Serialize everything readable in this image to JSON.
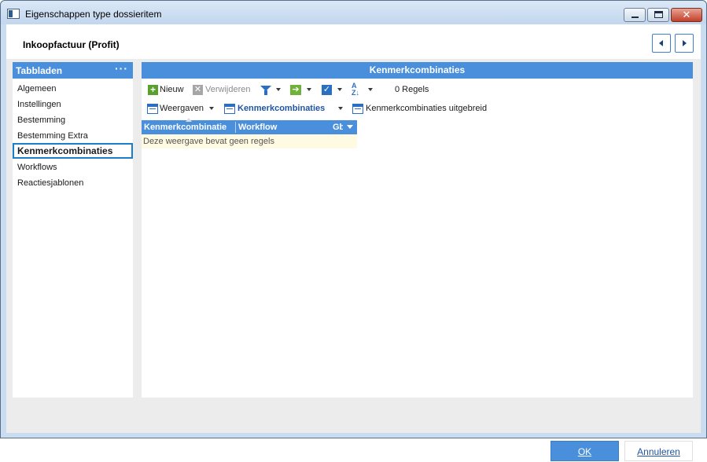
{
  "window": {
    "title": "Eigenschappen type dossieritem"
  },
  "header": {
    "title": "Inkoopfactuur (Profit)"
  },
  "sidebar": {
    "title": "Tabbladen",
    "more_icon": "ellipsis-icon",
    "items": [
      {
        "label": "Algemeen",
        "active": false
      },
      {
        "label": "Instellingen",
        "active": false
      },
      {
        "label": "Bestemming",
        "active": false
      },
      {
        "label": "Bestemming Extra",
        "active": false
      },
      {
        "label": "Kenmerkcombinaties",
        "active": true
      },
      {
        "label": "Workflows",
        "active": false
      },
      {
        "label": "Reactiesjablonen",
        "active": false
      }
    ]
  },
  "main": {
    "title": "Kenmerkcombinaties",
    "toolbar1": {
      "new_label": "Nieuw",
      "delete_label": "Verwijderen",
      "row_count": "0 Regels"
    },
    "toolbar2": {
      "views_label": "Weergaven",
      "current_view_label": "Kenmerkcombinaties",
      "extended_view_label": "Kenmerkcombinaties uitgebreid"
    },
    "grid": {
      "columns": [
        "Kenmerkcombinatie",
        "Workflow",
        "Gb"
      ],
      "empty_text": "Deze weergave bevat geen regels"
    }
  },
  "footer": {
    "ok_label": "OK",
    "cancel_label": "Annuleren"
  },
  "colors": {
    "accent": "#4a8fdb",
    "active_border": "#1a7fc8",
    "empty_row": "#fffbe2"
  }
}
